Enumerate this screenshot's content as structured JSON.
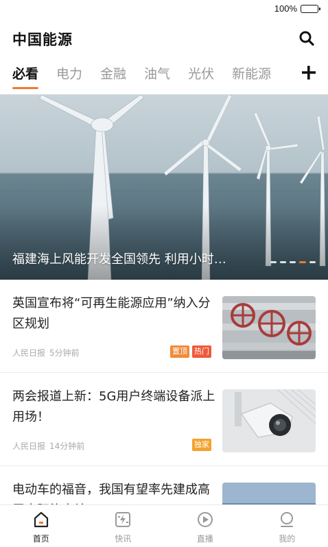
{
  "status_bar": {
    "battery_percent": "100%",
    "battery_level": 1.0
  },
  "header": {
    "title": "中国能源",
    "search_icon": "search-icon"
  },
  "tabs": [
    {
      "label": "必看",
      "active": true
    },
    {
      "label": "电力",
      "active": false
    },
    {
      "label": "金融",
      "active": false
    },
    {
      "label": "油气",
      "active": false
    },
    {
      "label": "光伏",
      "active": false
    },
    {
      "label": "新能源",
      "active": false
    }
  ],
  "tab_add_icon": "plus-icon",
  "banner": {
    "caption": "福建海上风能开发全国领先 利用小时…",
    "slide_count": 5,
    "active_slide_index": 3,
    "image": "offshore-wind-turbines"
  },
  "news": [
    {
      "title": "英国宣布将“可再生能源应用”纳入分区规划",
      "source": "人民日报",
      "time": "5分钟前",
      "tags": [
        {
          "label": "置顶",
          "color": "#f08a3a"
        },
        {
          "label": "热门",
          "color": "#ef5a3a"
        }
      ],
      "thumb": "pipeline-valves"
    },
    {
      "title": "两会报道上新：5G用户终端设备派上用场！",
      "source": "人民日报",
      "time": "14分钟前",
      "tags": [
        {
          "label": "独家",
          "color": "#f3a22e"
        }
      ],
      "thumb": "security-camera"
    },
    {
      "title": "电动车的福音，我国有望率先建成高层太阳能电站",
      "source": "",
      "time": "",
      "tags": [],
      "thumb": "solar-building"
    }
  ],
  "bottom_nav": [
    {
      "label": "首页",
      "icon": "home-icon",
      "active": true
    },
    {
      "label": "快讯",
      "icon": "flash-news-icon",
      "active": false
    },
    {
      "label": "直播",
      "icon": "live-play-icon",
      "active": false
    },
    {
      "label": "我的",
      "icon": "profile-icon",
      "active": false
    }
  ],
  "colors": {
    "accent": "#f07a2a",
    "text": "#222222",
    "muted": "#999999"
  }
}
